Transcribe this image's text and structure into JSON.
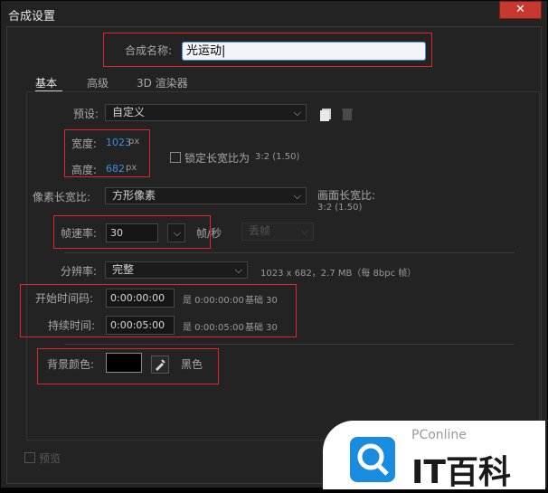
{
  "window": {
    "title": "合成设置",
    "close_glyph": "✕"
  },
  "comp_name": {
    "label": "合成名称:",
    "value": "光运动"
  },
  "tabs": [
    {
      "label": "基本"
    },
    {
      "label": "高级"
    },
    {
      "label": "3D 渲染器"
    }
  ],
  "preset": {
    "label": "预设:",
    "value": "自定义"
  },
  "width": {
    "label": "宽度:",
    "value": "1023",
    "unit": "px"
  },
  "height": {
    "label": "高度:",
    "value": "682",
    "unit": "px"
  },
  "lock_aspect": {
    "label": "锁定长宽比为",
    "ratio": "3:2 (1.50)",
    "checked": false
  },
  "pixel_aspect": {
    "label": "像素长宽比:",
    "value": "方形像素"
  },
  "frame_aspect": {
    "label": "画面长宽比:",
    "value": "3:2 (1.50)"
  },
  "frame_rate": {
    "label": "帧速率:",
    "value": "30",
    "unit": "帧/秒",
    "drop_frame": "丢帧"
  },
  "resolution": {
    "label": "分辨率:",
    "value": "完整",
    "info": "1023 x 682，2.7 MB（每 8bpc 帧）"
  },
  "start_timecode": {
    "label": "开始时间码:",
    "value": "0:00:00:00",
    "is_text": "是 0:00:00:00",
    "base": "基础 30"
  },
  "duration": {
    "label": "持续时间:",
    "value": "0:00:05:00",
    "is_text": "是 0:00:05:00",
    "base": "基础 30"
  },
  "background": {
    "label": "背景颜色:",
    "color_name": "黑色",
    "color": "#000000"
  },
  "preview": {
    "label": "预览"
  },
  "watermark": {
    "brand": "PConline",
    "name": "IT百科"
  },
  "colors": {
    "accent_blue": "#3b8fe0",
    "highlight_red": "#e0262b",
    "close_red": "#c8382f"
  }
}
